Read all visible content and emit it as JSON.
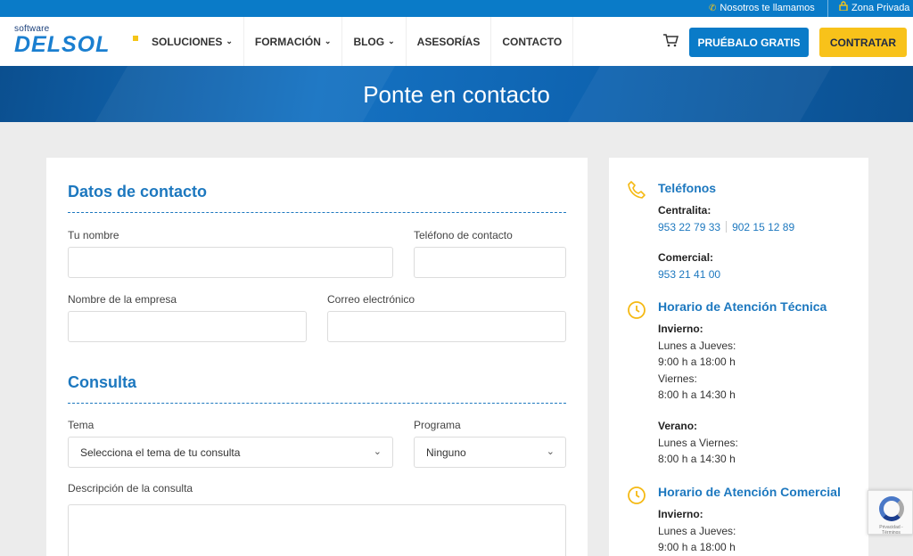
{
  "topbar": {
    "call_label": "Nosotros te llamamos",
    "private_label": "Zona Privada"
  },
  "header": {
    "logo_small": "software",
    "logo_big": "DELSOL",
    "nav": [
      {
        "label": "SOLUCIONES",
        "has_dropdown": true
      },
      {
        "label": "FORMACIÓN",
        "has_dropdown": true
      },
      {
        "label": "BLOG",
        "has_dropdown": true
      },
      {
        "label": "ASESORÍAS",
        "has_dropdown": false
      },
      {
        "label": "CONTACTO",
        "has_dropdown": false
      }
    ],
    "try_button": "PRUÉBALO GRATIS",
    "buy_button": "CONTRATAR"
  },
  "banner": {
    "title": "Ponte en contacto"
  },
  "form": {
    "contact_section_title": "Datos de contacto",
    "name_label": "Tu nombre",
    "phone_label": "Teléfono de contacto",
    "company_label": "Nombre de la empresa",
    "email_label": "Correo electrónico",
    "query_section_title": "Consulta",
    "topic_label": "Tema",
    "topic_value": "Selecciona el tema de tu consulta",
    "program_label": "Programa",
    "program_value": "Ninguno",
    "description_label": "Descripción de la consulta"
  },
  "info": {
    "phones_title": "Teléfonos",
    "switchboard_label": "Centralita:",
    "switchboard_phone_1": "953 22 79 33",
    "switchboard_phone_2": "902 15 12 89",
    "sales_label": "Comercial:",
    "sales_phone": "953 21 41 00",
    "tech_title": "Horario de Atención Técnica",
    "tech_winter_label": "Invierno:",
    "tech_winter_days_1": "Lunes a Jueves:",
    "tech_winter_hours_1": "9:00 h a 18:00 h",
    "tech_winter_days_2": "Viernes:",
    "tech_winter_hours_2": "8:00 h a 14:30 h",
    "tech_summer_label": "Verano:",
    "tech_summer_days": "Lunes a Viernes:",
    "tech_summer_hours": "8:00 h a 14:30 h",
    "sales_hours_title": "Horario de Atención Comercial",
    "sales_winter_label": "Invierno:",
    "sales_winter_days_1": "Lunes a Jueves:",
    "sales_winter_hours_1": "9:00 h a 18:00 h"
  },
  "recaptcha": {
    "text": "Privacidad - Términos"
  },
  "colors": {
    "brand_blue": "#0a7bc8",
    "accent_yellow": "#f8c21a",
    "heading_blue": "#1d78bf"
  }
}
